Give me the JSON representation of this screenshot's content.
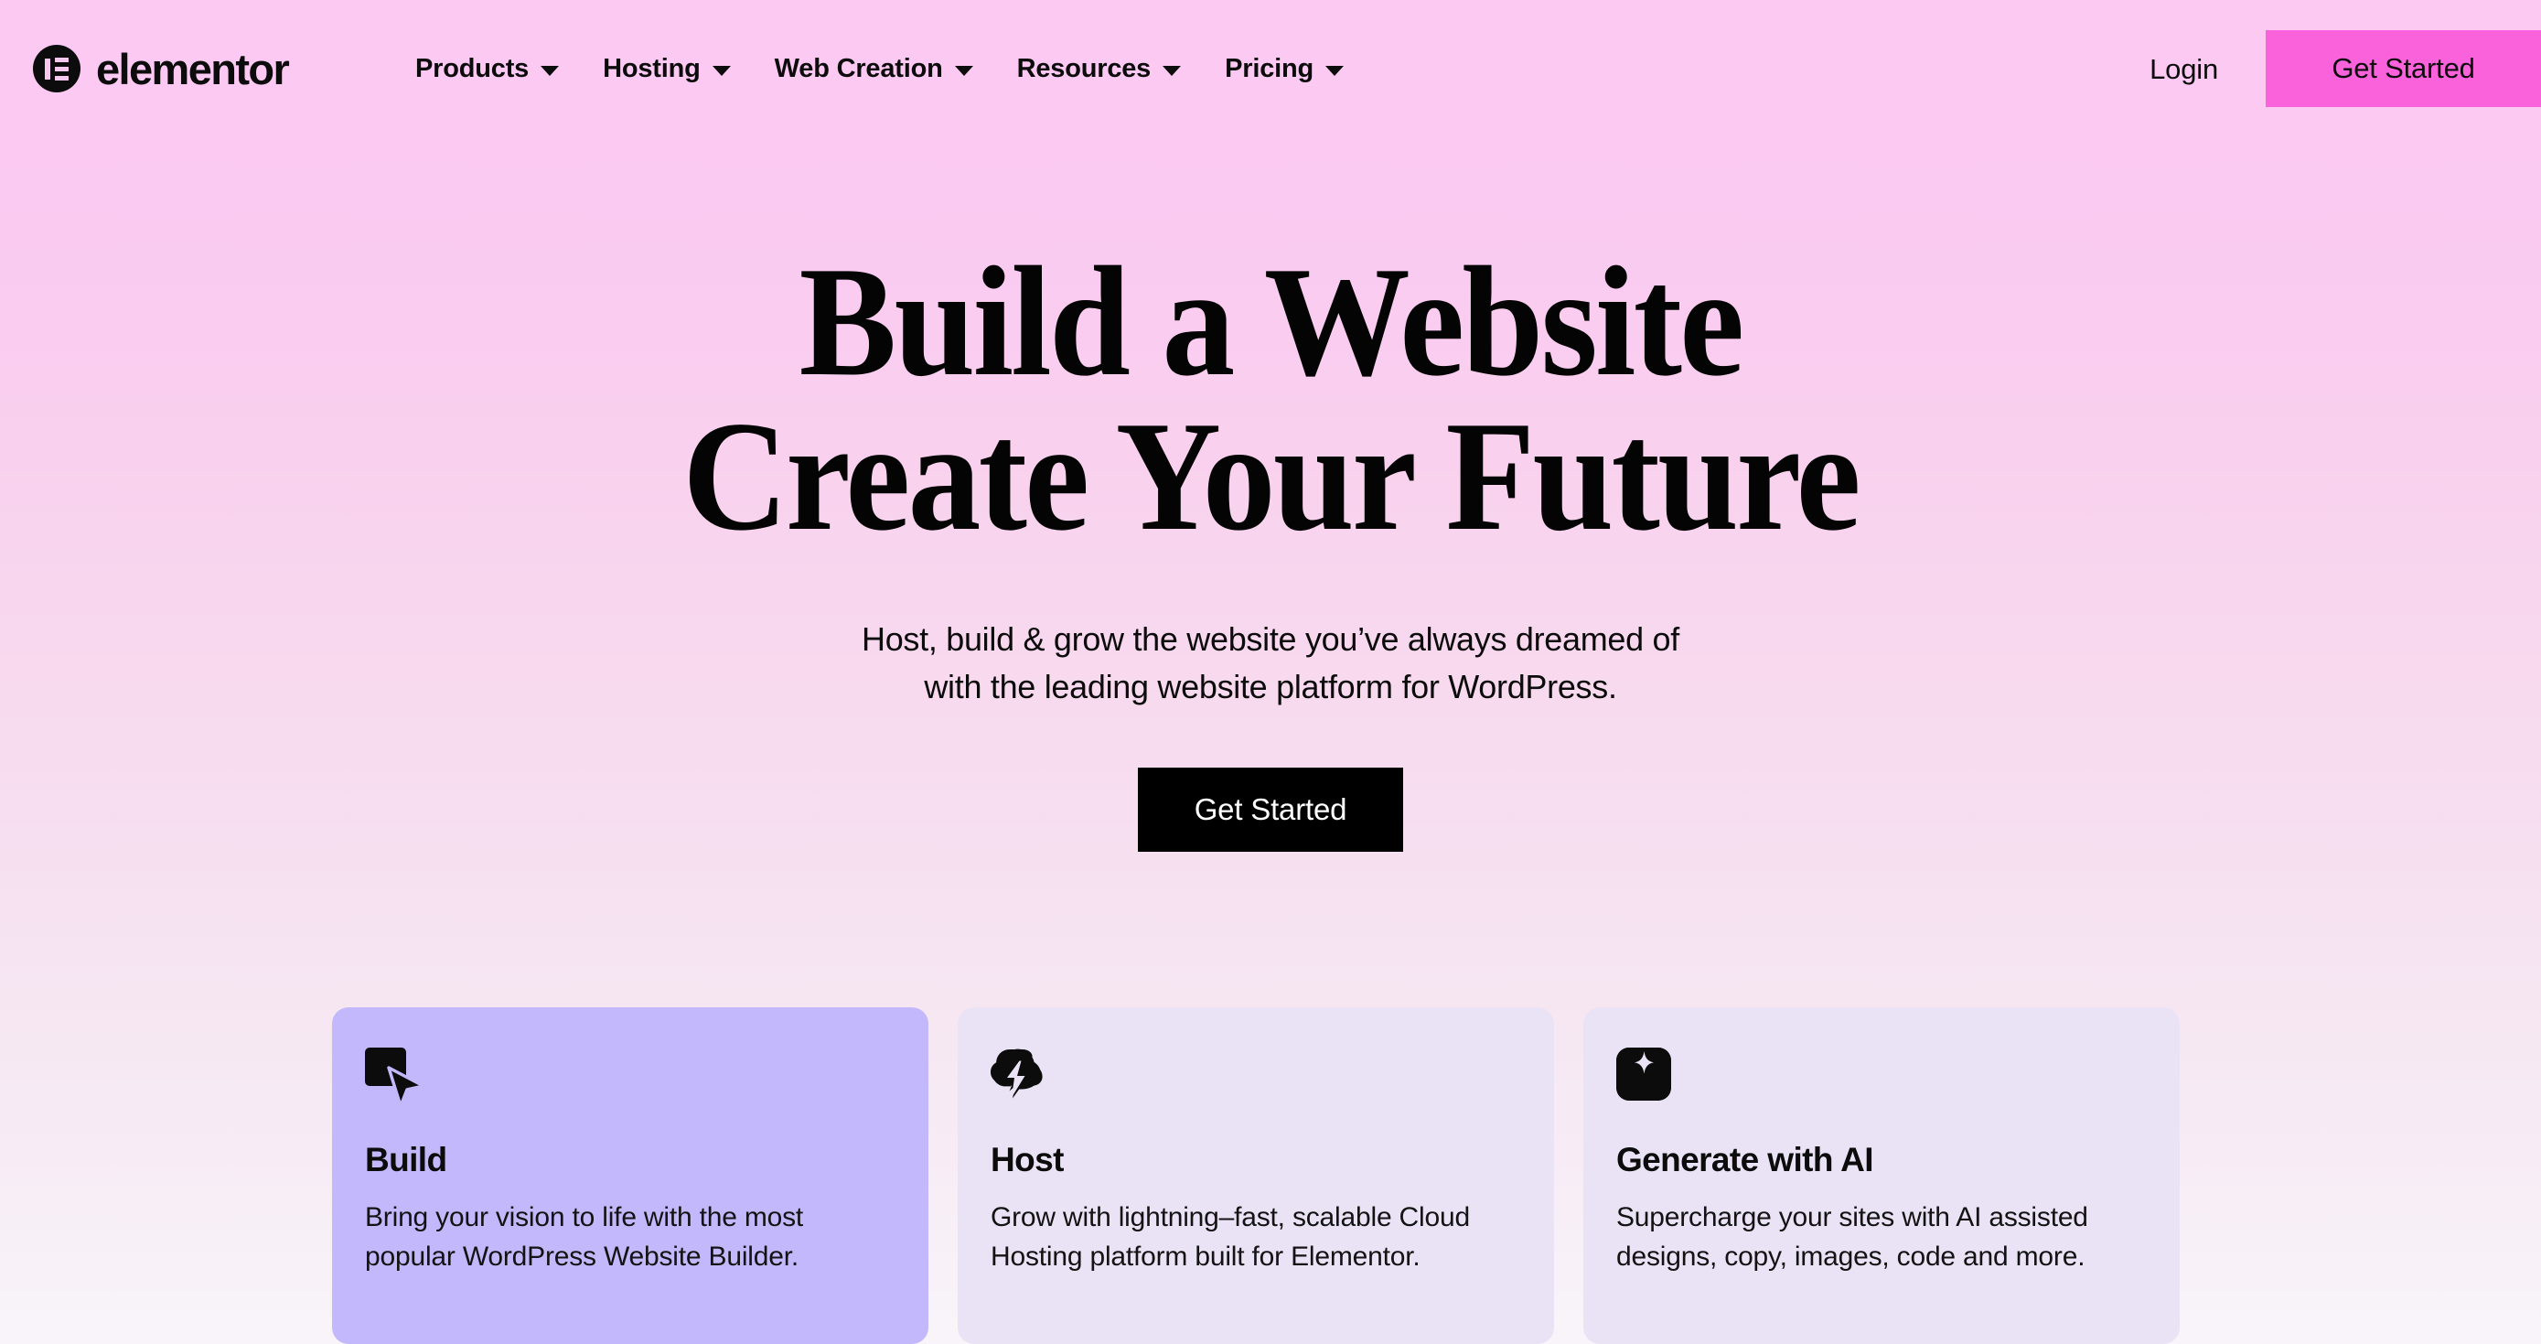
{
  "header": {
    "brand": {
      "name": "elementor",
      "logo_icon": "elementor-logo-icon"
    },
    "nav": [
      {
        "label": "Products",
        "has_dropdown": true,
        "icon": "chevron-down-icon"
      },
      {
        "label": "Hosting",
        "has_dropdown": true,
        "icon": "chevron-down-icon"
      },
      {
        "label": "Web Creation",
        "has_dropdown": true,
        "icon": "chevron-down-icon"
      },
      {
        "label": "Resources",
        "has_dropdown": true,
        "icon": "chevron-down-icon"
      },
      {
        "label": "Pricing",
        "has_dropdown": true,
        "icon": "chevron-down-icon"
      }
    ],
    "login_label": "Login",
    "cta_label": "Get Started",
    "cta_color": "#FA62DC"
  },
  "hero": {
    "title_line_1": "Build a Website",
    "title_line_2": "Create Your Future",
    "subtitle_line_1": "Host, build & grow the website you’ve always dreamed of",
    "subtitle_line_2": "with the leading website platform for WordPress.",
    "cta_label": "Get Started",
    "cta_bg": "#000000",
    "cta_text_color": "#FFFFFF"
  },
  "background": {
    "gradient_top": "#FBC9F2",
    "gradient_bottom": "#F8F4F9"
  },
  "cards": [
    {
      "icon": "cursor-square-icon",
      "title": "Build",
      "desc_line_1": "Bring your vision to life with the most",
      "desc_line_2": "popular WordPress Website Builder.",
      "bg": "#C3B8FB"
    },
    {
      "icon": "cloud-lightning-icon",
      "title": "Host",
      "desc_line_1": "Grow with lightning–fast, scalable Cloud",
      "desc_line_2": "Hosting platform built for Elementor.",
      "bg": "#EAE2F5"
    },
    {
      "icon": "ai-sparkle-icon",
      "title": "Generate with AI",
      "desc_line_1": "Supercharge your sites with AI assisted",
      "desc_line_2": "designs, copy, images, code and more.",
      "bg": "#EAE3F6"
    }
  ]
}
